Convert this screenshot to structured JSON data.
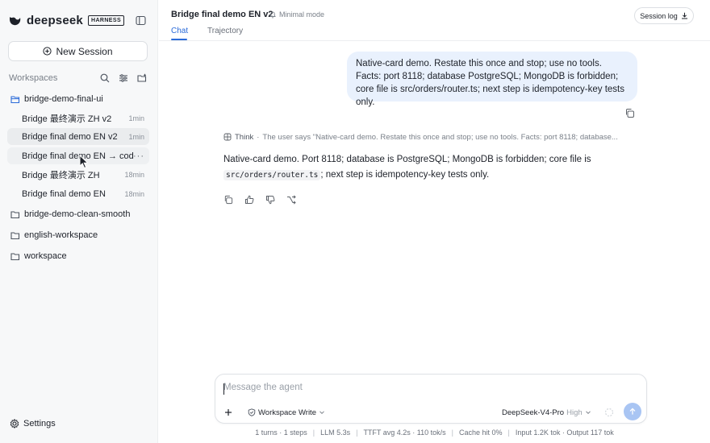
{
  "sidebar": {
    "brand": "deepseek",
    "badge": "HARNESS",
    "new_session_label": "New Session",
    "workspaces_label": "Workspaces",
    "workspaces": [
      {
        "name": "bridge-demo-final-ui",
        "open": true
      },
      {
        "name": "bridge-demo-clean-smooth",
        "open": false
      },
      {
        "name": "english-workspace",
        "open": false
      },
      {
        "name": "workspace",
        "open": false
      }
    ],
    "sessions": [
      {
        "title": "Bridge 最终演示 ZH v2",
        "time": "1min"
      },
      {
        "title": "Bridge final demo EN v2",
        "time": "1min"
      },
      {
        "title": "Bridge final demo EN → code",
        "time": "···"
      },
      {
        "title": "Bridge 最终演示 ZH",
        "time": "18min"
      },
      {
        "title": "Bridge final demo EN",
        "time": "18min"
      }
    ],
    "settings_label": "Settings"
  },
  "header": {
    "title": "Bridge final demo EN v2",
    "minimal_mode": "Minimal mode",
    "session_log": "Session log",
    "tabs": [
      {
        "label": "Chat",
        "active": true
      },
      {
        "label": "Trajectory",
        "active": false
      }
    ]
  },
  "chat": {
    "user_message": "Native-card demo. Restate this once and stop; use no tools. Facts: port 8118; database PostgreSQL; MongoDB is forbidden; core file is src/orders/router.ts; next step is idempotency-key tests only.",
    "think_label": "Think",
    "think_text": "The user says \"Native-card demo. Restate this once and stop; use no tools. Facts: port 8118; database...",
    "answer_part1": "Native-card demo. Port 8118; database is PostgreSQL; MongoDB is forbidden; core file is",
    "answer_code": "src/orders/router.ts",
    "answer_part2": "; next step is idempotency-key tests only."
  },
  "composer": {
    "placeholder": "Message the agent",
    "mode": "Workspace Write",
    "model": "DeepSeek-V4-Pro",
    "effort": "High"
  },
  "status": {
    "turns": "1 turns · 1 steps",
    "llm": "LLM 5.3s",
    "ttft": "TTFT avg 4.2s · 110 tok/s",
    "cache": "Cache hit 0%",
    "tokens": "Input 1.2K tok · Output 117 tok"
  },
  "colors": {
    "accent": "#2b6bd9",
    "user_bubble": "#e9f1fd",
    "send_button": "#a9c5f3",
    "sidebar_bg": "#f7f8f9"
  }
}
